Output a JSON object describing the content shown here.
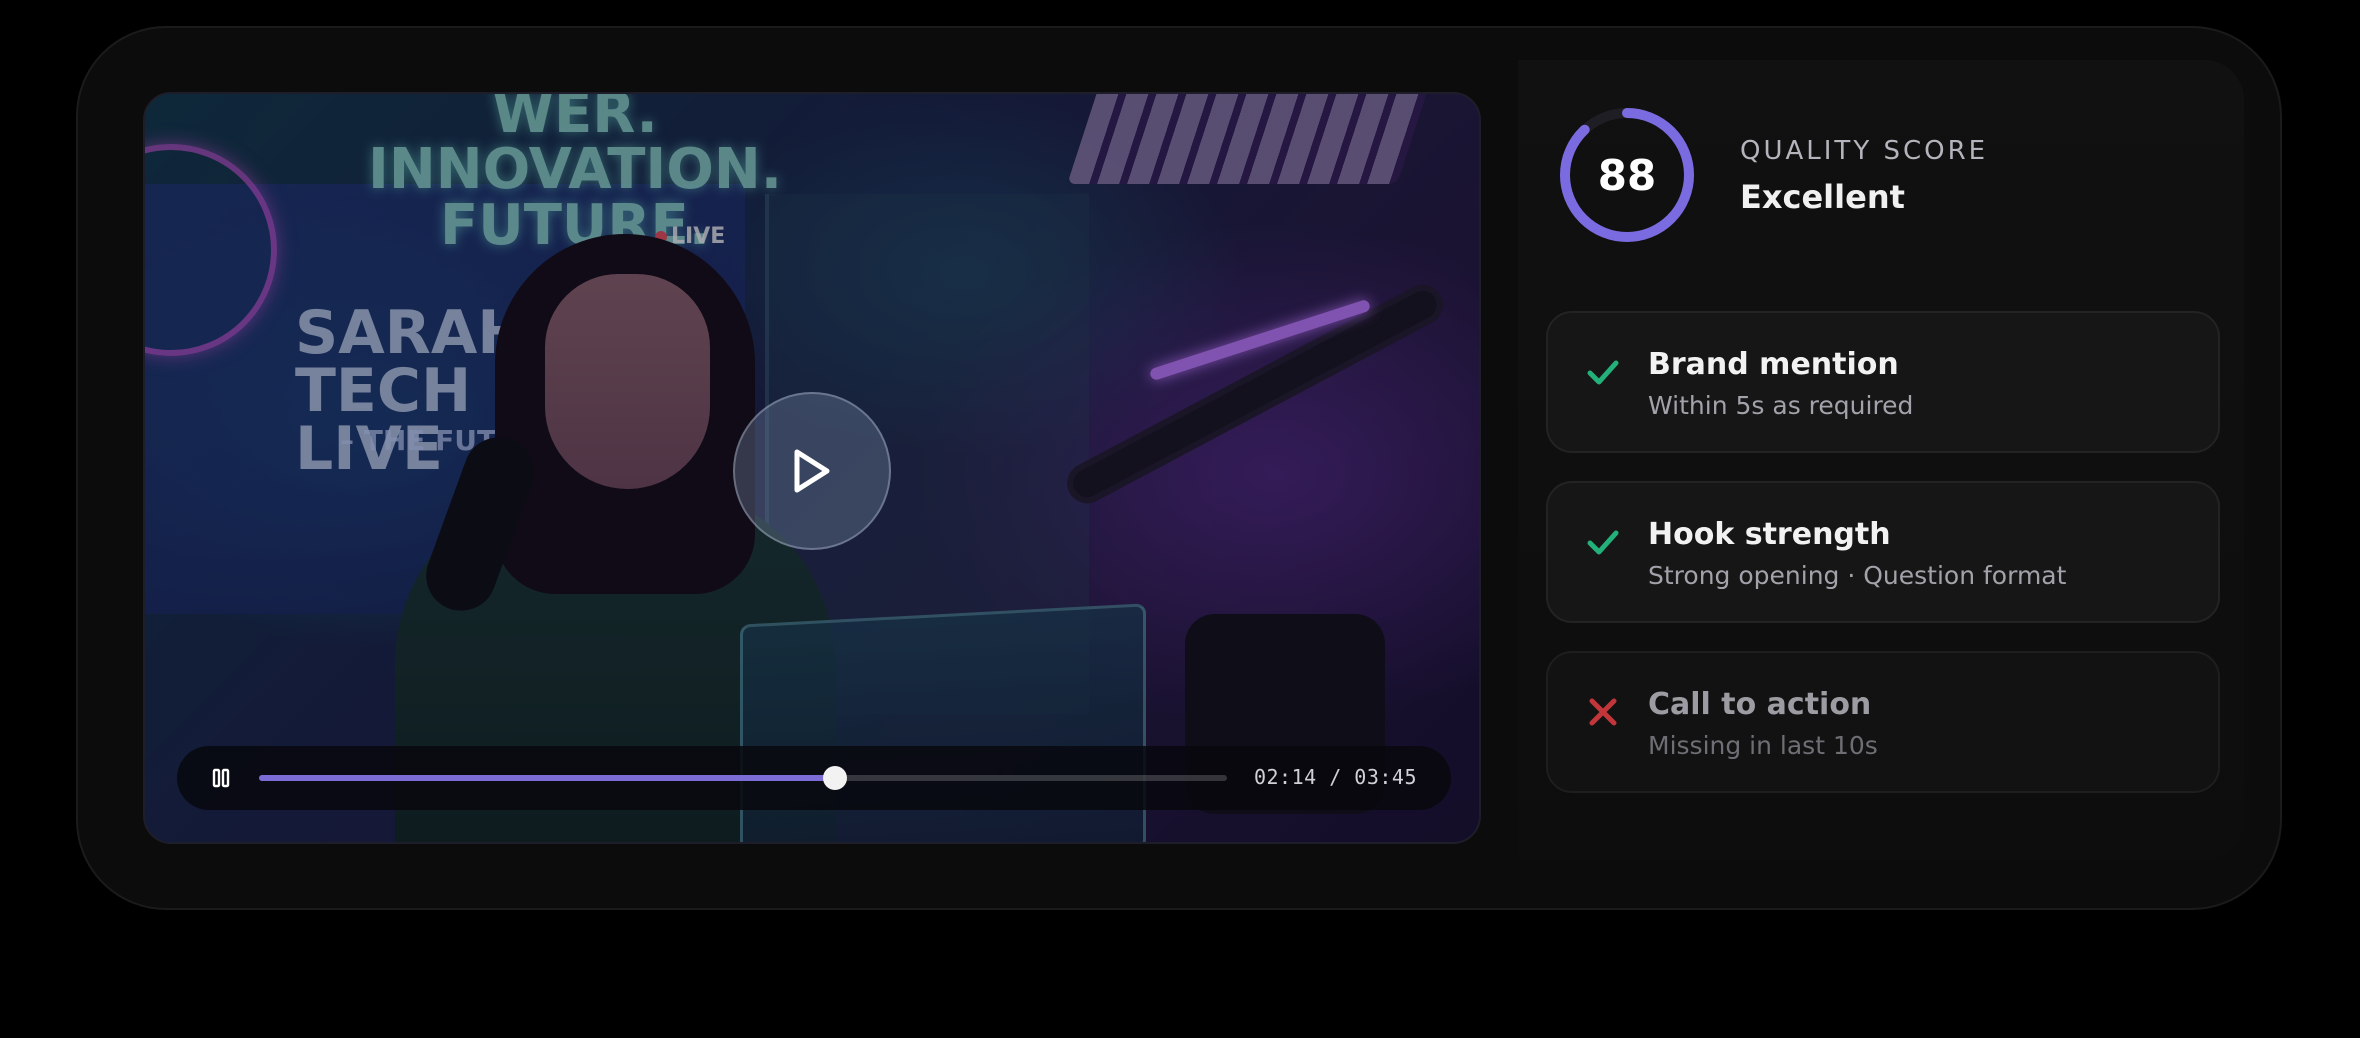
{
  "player": {
    "current_time": "02:14",
    "duration": "03:45",
    "time_display": "02:14 / 03:45",
    "progress": 0.595,
    "state": "paused",
    "play_icon": "play-icon",
    "pause_icon": "pause-icon"
  },
  "video_scene": {
    "neon_top": "WER. INNOVATION. FUTURE.",
    "show_title": "SARAH'S TECH LIVE",
    "show_subtitle": "– THE FUTURE",
    "live_badge": "LIVE"
  },
  "score": {
    "value": 88,
    "label": "QUALITY SCORE",
    "status": "Excellent",
    "fraction": 0.88,
    "ring_color": "#7b6be0",
    "ring_track_color": "#1e1e24"
  },
  "checks": [
    {
      "title": "Brand mention",
      "subtitle": "Within 5s as required",
      "passed": true,
      "icon": "check-icon",
      "color": "#23b07a"
    },
    {
      "title": "Hook strength",
      "subtitle": "Strong opening · Question format",
      "passed": true,
      "icon": "check-icon",
      "color": "#23b07a"
    },
    {
      "title": "Call to action",
      "subtitle": "Missing in last 10s",
      "passed": false,
      "icon": "close-icon",
      "color": "#c0363b"
    }
  ]
}
